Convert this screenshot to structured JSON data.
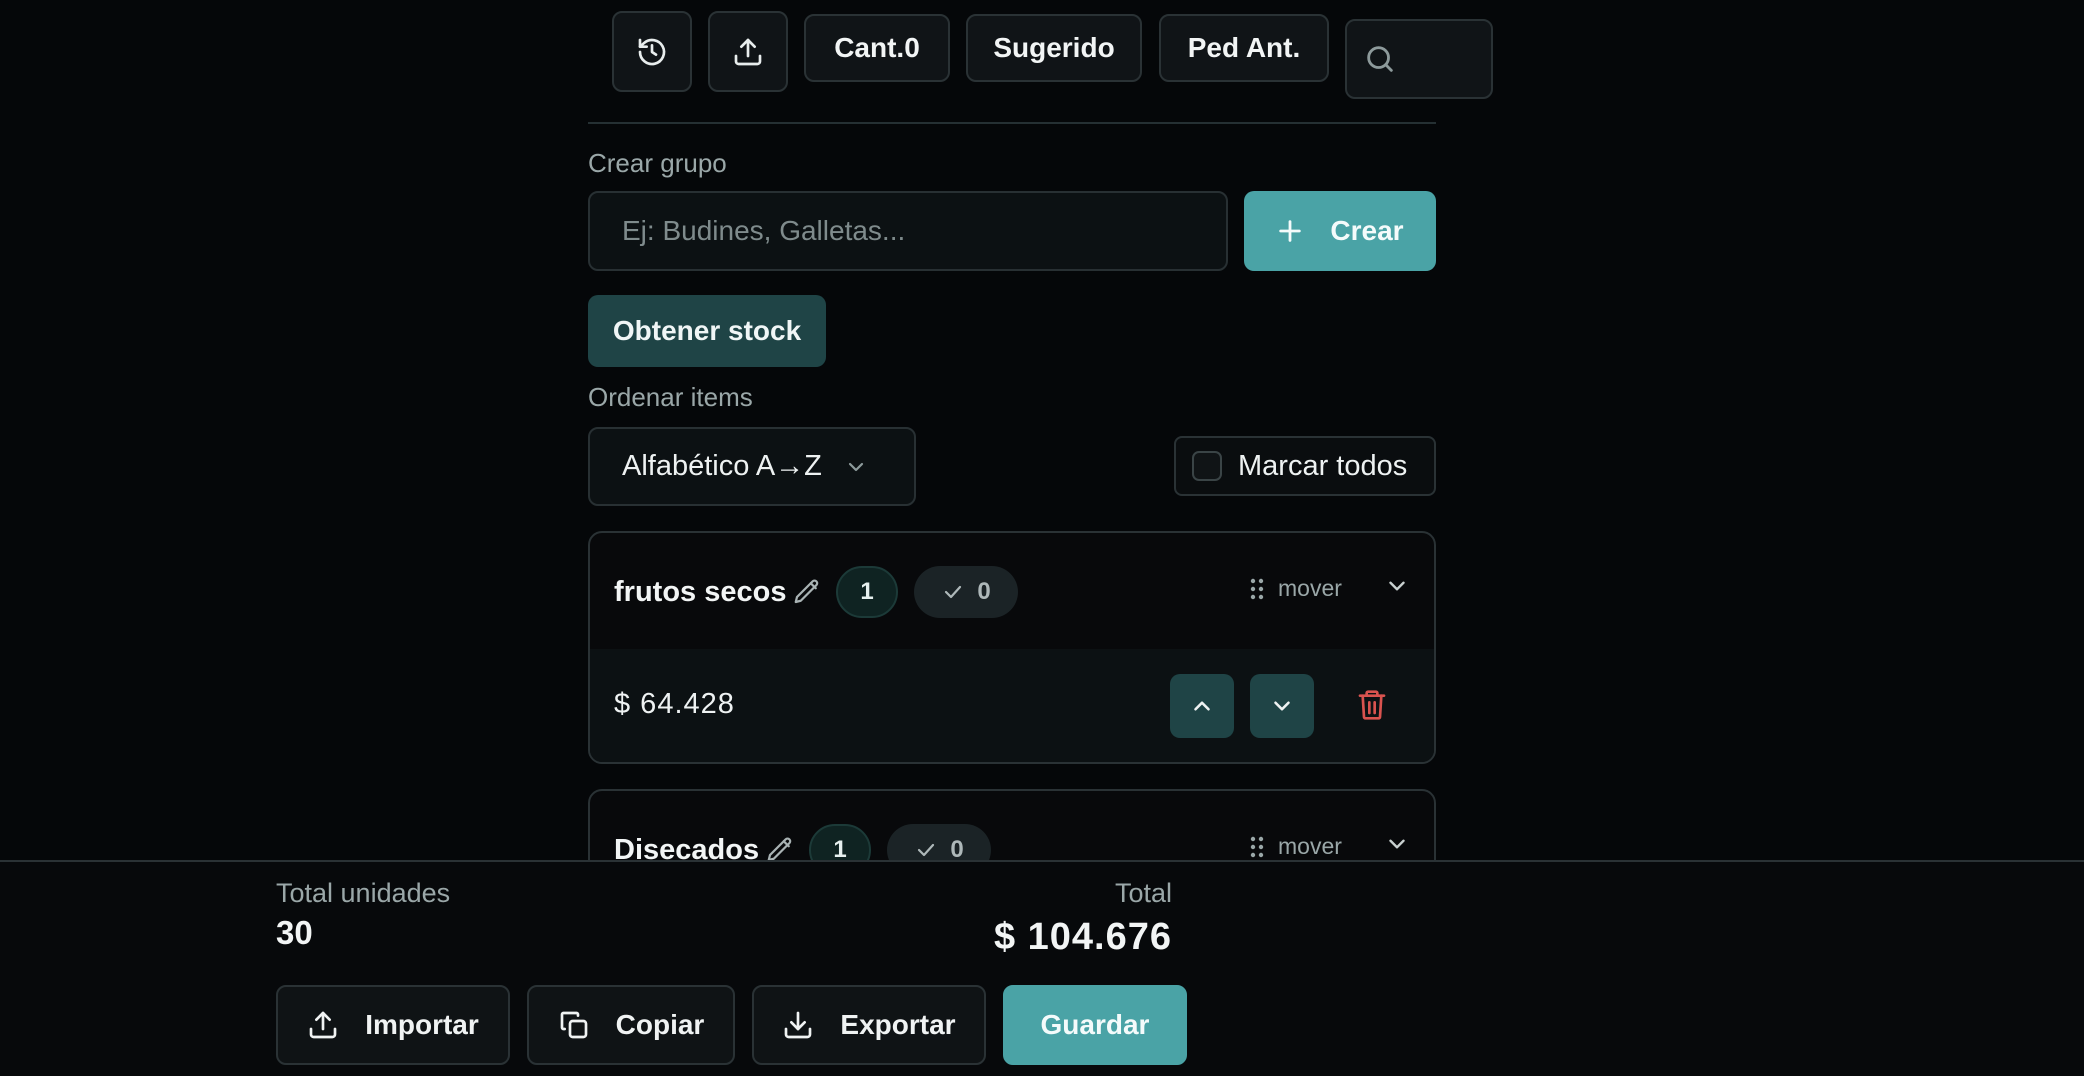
{
  "toolbar": {
    "history_icon": "history-icon",
    "upload_icon": "upload-icon",
    "cant_label": "Cant.0",
    "sugerido_label": "Sugerido",
    "ped_ant_label": "Ped Ant.",
    "search_icon": "search-icon"
  },
  "create_group": {
    "label": "Crear grupo",
    "placeholder": "Ej: Budines, Galletas...",
    "button_label": "Crear"
  },
  "stock_button_label": "Obtener stock",
  "sort": {
    "label": "Ordenar items",
    "selected": "Alfabético A→Z"
  },
  "mark_all_label": "Marcar todos",
  "groups": [
    {
      "name": "frutos secos",
      "count": "1",
      "checked": "0",
      "move_label": "mover",
      "price": "$ 64.428"
    },
    {
      "name": "Disecados",
      "count": "1",
      "checked": "0",
      "move_label": "mover"
    }
  ],
  "footer": {
    "units_label": "Total unidades",
    "units_value": "30",
    "total_label": "Total",
    "total_value": "$ 104.676",
    "import_label": "Importar",
    "copy_label": "Copiar",
    "export_label": "Exportar",
    "save_label": "Guardar"
  },
  "colors": {
    "accent": "#4aa3a6",
    "accent_dark": "#1f4446",
    "danger": "#d9534f",
    "background": "#050709"
  }
}
